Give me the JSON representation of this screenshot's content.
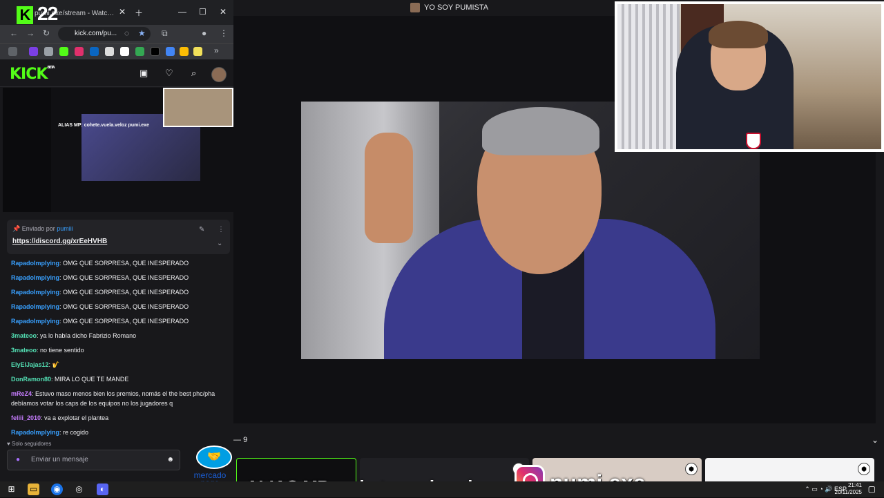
{
  "stream": {
    "title": "YO SOY PUMISTA",
    "counter": "9",
    "alias": "ALIAS MP: cohete.vuela.veloz",
    "instagram": "pumi.exe"
  },
  "browser": {
    "overlay_label": "22",
    "tab_title": "pumi.exe/stream - Watch Live on Kick",
    "url": "kick.com/pu..."
  },
  "kick": {
    "logo": "KICK",
    "beta": "BETA",
    "pinned": {
      "sent_by": "Enviado por",
      "user": "pumiii",
      "link": "https://discord.gg/xrEeHVHB"
    },
    "mini_banner": "ALIAS MP: cohete.vuela.veloz",
    "mini_handle": "pumi.exe",
    "messages": [
      {
        "user": "RapadoImplying",
        "color": "#38a0ff",
        "text": "OMG QUE SORPRESA, QUE INESPERADO"
      },
      {
        "user": "RapadoImplying",
        "color": "#38a0ff",
        "text": "OMG QUE SORPRESA, QUE INESPERADO"
      },
      {
        "user": "RapadoImplying",
        "color": "#38a0ff",
        "text": "OMG QUE SORPRESA, QUE INESPERADO"
      },
      {
        "user": "RapadoImplying",
        "color": "#38a0ff",
        "text": "OMG QUE SORPRESA, QUE INESPERADO"
      },
      {
        "user": "RapadoImplying",
        "color": "#38a0ff",
        "text": "OMG QUE SORPRESA, QUE INESPERADO"
      },
      {
        "user": "3mateoo",
        "color": "#53e0b4",
        "text": "ya lo había dicho Fabrizio Romano"
      },
      {
        "user": "3mateoo",
        "color": "#53e0b4",
        "text": "no tiene sentido"
      },
      {
        "user": "ElyElJajas12",
        "color": "#53e0b4",
        "text": "🎷"
      },
      {
        "user": "DonRamon80",
        "color": "#53e0b4",
        "text": "MIRA LO QUE TE MANDE"
      },
      {
        "user": "mReZ4",
        "color": "#c77dff",
        "text": "Estuvo maso menos bien los premios, nomás el the best phc/pha debíamos votar los caps de los equipos no los jugadores q"
      },
      {
        "user": "feliii_2010",
        "color": "#c77dff",
        "text": "va a explotar el plantea"
      },
      {
        "user": "RapadoImplying",
        "color": "#38a0ff",
        "text": "re cogido"
      }
    ],
    "followers_only": "Solo seguidores",
    "input_placeholder": "Enviar un mensaje",
    "mp_text": "mercado pago"
  },
  "taskbar": {
    "lang": "ESP",
    "time": "21:41",
    "date": "20/11/2025"
  }
}
